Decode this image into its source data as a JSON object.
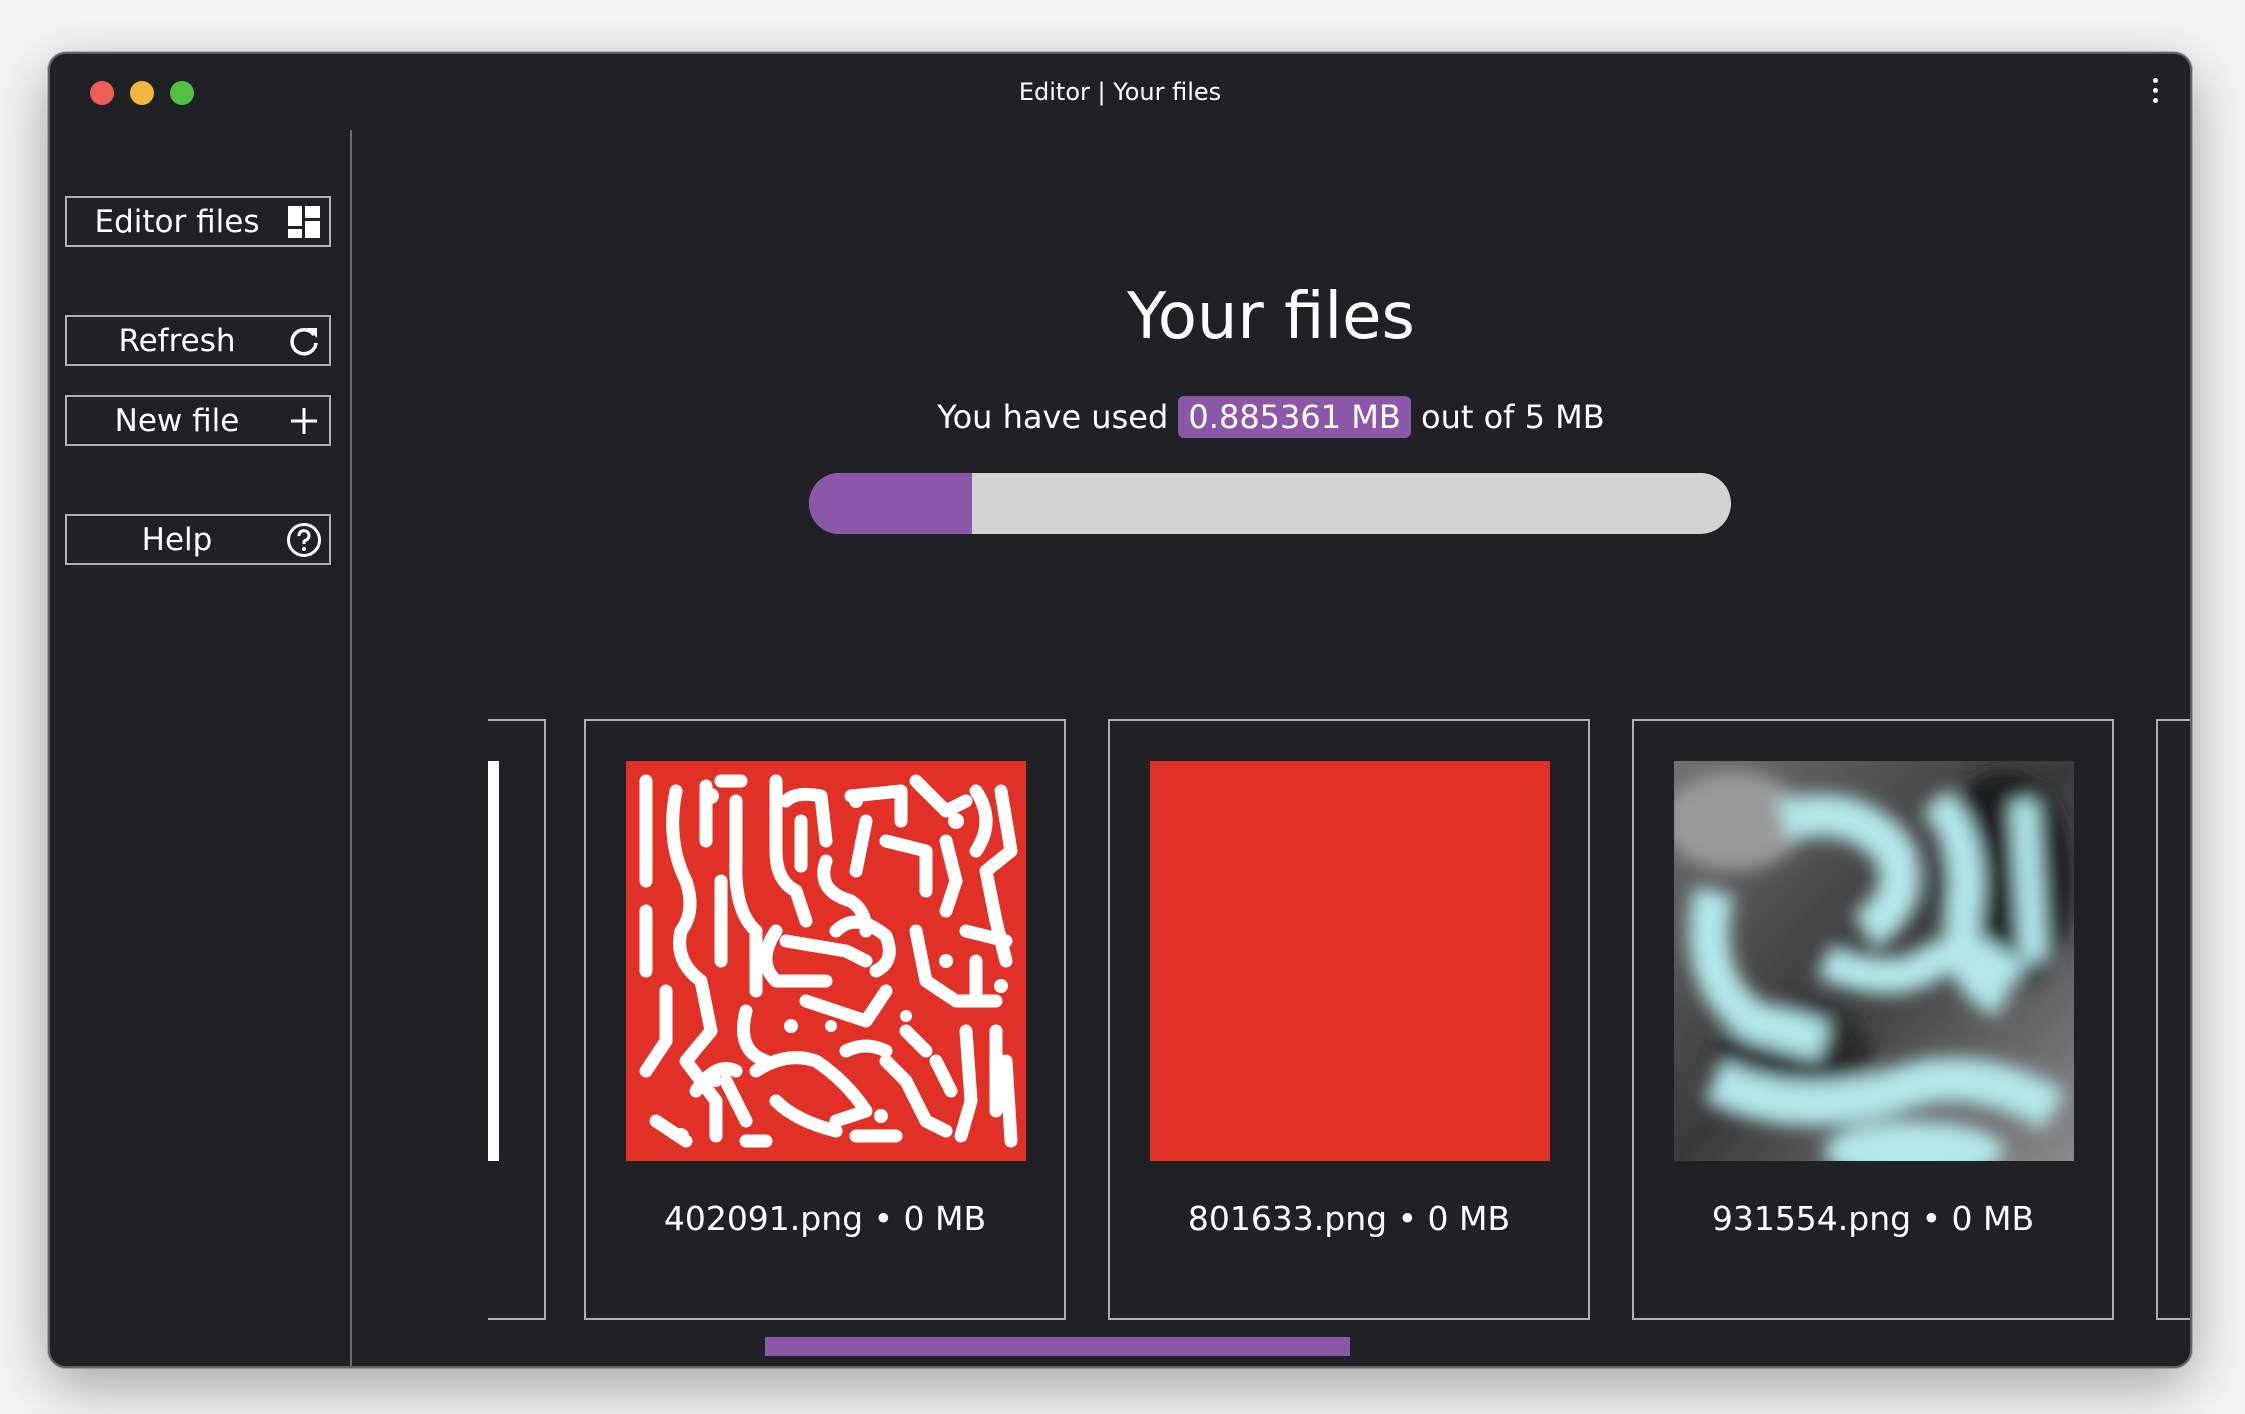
{
  "window": {
    "title": "Editor | Your files"
  },
  "sidebar": {
    "items": [
      {
        "label": "Editor files",
        "icon": "grid-icon"
      },
      {
        "label": "Refresh",
        "icon": "refresh-icon"
      },
      {
        "label": "New file",
        "icon": "plus-icon"
      },
      {
        "label": "Help",
        "icon": "help-icon"
      }
    ]
  },
  "main": {
    "title": "Your files",
    "usage_prefix": "You have used",
    "usage_used": "0.885361 MB",
    "usage_suffix": "out of 5 MB",
    "usage_fraction": 0.177
  },
  "files": [
    {
      "label": "402091.png • 0 MB",
      "thumbnail": "red-white-maze"
    },
    {
      "label": "801633.png • 0 MB",
      "thumbnail": "solid-red"
    },
    {
      "label": "931554.png • 0 MB",
      "thumbnail": "cyan-gray-blur"
    }
  ],
  "colors": {
    "accent": "#8b57a8",
    "background": "#202124",
    "red": "#e13126",
    "cyan": "#b4e8ea"
  }
}
